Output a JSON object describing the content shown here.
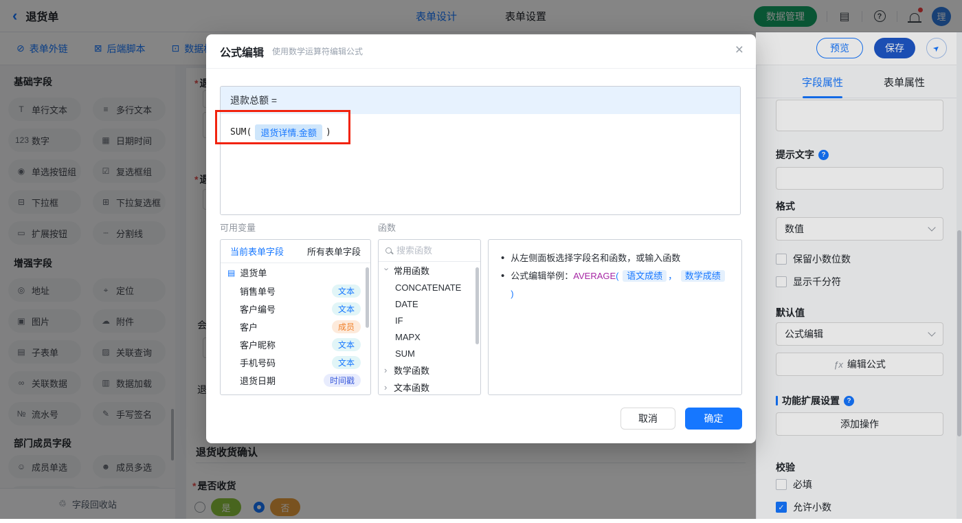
{
  "topbar": {
    "title": "退货单",
    "tabs": [
      {
        "label": "表单设计",
        "active": true
      },
      {
        "label": "表单设置",
        "active": false
      }
    ],
    "data_manage_label": "数据管理",
    "avatar_text": "理"
  },
  "toolbar": {
    "links": [
      {
        "label": "表单外链",
        "icon": "external-link"
      },
      {
        "label": "后端脚本",
        "icon": "backend-script"
      },
      {
        "label": "数据权",
        "icon": "data-permission"
      }
    ],
    "preview_label": "预览",
    "save_label": "保存"
  },
  "left_sidebar": {
    "sections": [
      {
        "title": "基础字段",
        "items": [
          {
            "label": "单行文本",
            "icon": "single-line-text"
          },
          {
            "label": "多行文本",
            "icon": "multi-line-text"
          },
          {
            "label": "数字",
            "icon": "number"
          },
          {
            "label": "日期时间",
            "icon": "datetime"
          },
          {
            "label": "单选按钮组",
            "icon": "radio-group"
          },
          {
            "label": "复选框组",
            "icon": "checkbox-group"
          },
          {
            "label": "下拉框",
            "icon": "dropdown"
          },
          {
            "label": "下拉复选框",
            "icon": "dropdown-multi"
          },
          {
            "label": "扩展按钮",
            "icon": "extend-button"
          },
          {
            "label": "分割线",
            "icon": "divider"
          }
        ]
      },
      {
        "title": "增强字段",
        "items": [
          {
            "label": "地址",
            "icon": "address"
          },
          {
            "label": "定位",
            "icon": "location"
          },
          {
            "label": "图片",
            "icon": "image"
          },
          {
            "label": "附件",
            "icon": "attachment"
          },
          {
            "label": "子表单",
            "icon": "subform"
          },
          {
            "label": "关联查询",
            "icon": "related-query"
          },
          {
            "label": "关联数据",
            "icon": "related-data"
          },
          {
            "label": "数据加载",
            "icon": "data-load"
          },
          {
            "label": "流水号",
            "icon": "serial-number"
          },
          {
            "label": "手写签名",
            "icon": "signature"
          }
        ]
      },
      {
        "title": "部门成员字段",
        "items": [
          {
            "label": "成员单选",
            "icon": "member-single"
          },
          {
            "label": "成员多选",
            "icon": "member-multi"
          }
        ]
      }
    ],
    "recycle_label": "字段回收站"
  },
  "canvas": {
    "required_mark": "*",
    "field_fragments": [
      "退",
      "退",
      "会",
      "退"
    ],
    "section_title": "退货收货确认",
    "question_label": "是否收货",
    "options": [
      {
        "label": "是",
        "style": "green",
        "selected": false
      },
      {
        "label": "否",
        "style": "orange",
        "selected": true
      }
    ]
  },
  "modal": {
    "title": "公式编辑",
    "subtitle": "使用数学运算符编辑公式",
    "formula": {
      "target_label": "退款总额 =",
      "function_open": "SUM(",
      "field_token": "退货详情.金额",
      "function_close": ")"
    },
    "variables": {
      "label": "可用变量",
      "tabs": [
        {
          "label": "当前表单字段",
          "active": true
        },
        {
          "label": "所有表单字段",
          "active": false
        }
      ],
      "root": "退货单",
      "fields": [
        {
          "name": "销售单号",
          "type": "文本",
          "style": "blue"
        },
        {
          "name": "客户编号",
          "type": "文本",
          "style": "blue"
        },
        {
          "name": "客户",
          "type": "成员",
          "style": "orange"
        },
        {
          "name": "客户昵称",
          "type": "文本",
          "style": "blue"
        },
        {
          "name": "手机号码",
          "type": "文本",
          "style": "blue"
        },
        {
          "name": "退货日期",
          "type": "时间戳",
          "style": "purple"
        }
      ]
    },
    "functions": {
      "label": "函数",
      "search_placeholder": "搜索函数",
      "groups": [
        {
          "name": "常用函数",
          "expanded": true,
          "items": [
            "CONCATENATE",
            "DATE",
            "IF",
            "MAPX",
            "SUM"
          ]
        },
        {
          "name": "数学函数",
          "expanded": false
        },
        {
          "name": "文本函数",
          "expanded": false
        }
      ]
    },
    "help": {
      "line1": "从左侧面板选择字段名和函数，或输入函数",
      "example_prefix": "公式编辑举例：",
      "func": "AVERAGE",
      "open": "(",
      "field1": "语文成绩",
      "comma": "，",
      "field2": "数学成绩",
      "close": ")"
    },
    "cancel_label": "取消",
    "confirm_label": "确定"
  },
  "right_panel": {
    "tabs": [
      {
        "label": "字段属性",
        "active": true
      },
      {
        "label": "表单属性",
        "active": false
      }
    ],
    "hint_label": "提示文字",
    "format_label": "格式",
    "format_value": "数值",
    "format_checkboxes": [
      {
        "label": "保留小数位数",
        "checked": false
      },
      {
        "label": "显示千分符",
        "checked": false
      }
    ],
    "default_label": "默认值",
    "default_value": "公式编辑",
    "fx_prefix": "ƒx",
    "edit_formula_label": "编辑公式",
    "ext_settings_label": "功能扩展设置",
    "add_action_label": "添加操作",
    "validate_label": "校验",
    "validate_checkboxes": [
      {
        "label": "必填",
        "checked": false
      },
      {
        "label": "允许小数",
        "checked": true
      }
    ]
  },
  "colors": {
    "primary_blue": "#1677ff",
    "save_button_blue": "#1f57c8",
    "data_manage_green": "#12a364",
    "annotation_red": "#f1230e",
    "chip_text": "#e1f5f7",
    "chip_member": "#f0812c",
    "chip_timestamp": "#3b5bdb",
    "option_yes_green": "#8bc23a",
    "option_no_orange": "#e89d3c",
    "example_function_purple": "#a626a4"
  }
}
